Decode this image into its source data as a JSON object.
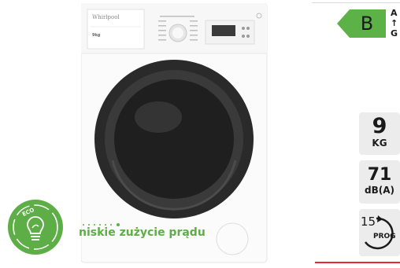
{
  "energy_label": {
    "class": "B",
    "scale_top": "A",
    "scale_arrow": "↑",
    "scale_bottom": "G",
    "color": "#5cb247"
  },
  "specs": {
    "capacity": {
      "value": "9",
      "unit": "KG"
    },
    "noise": {
      "value": "71",
      "unit": "dB(A)"
    },
    "programs": {
      "value": "15",
      "unit": "PROG"
    }
  },
  "product": {
    "brand": "Whirlpool",
    "badge": "9kg",
    "colors": {
      "body": "#ffffff",
      "door_ring": "#2b2b2b"
    }
  },
  "eco": {
    "badge_text": "ECO",
    "tagline": "niskie zużycie prądu",
    "color": "#5dae46"
  }
}
